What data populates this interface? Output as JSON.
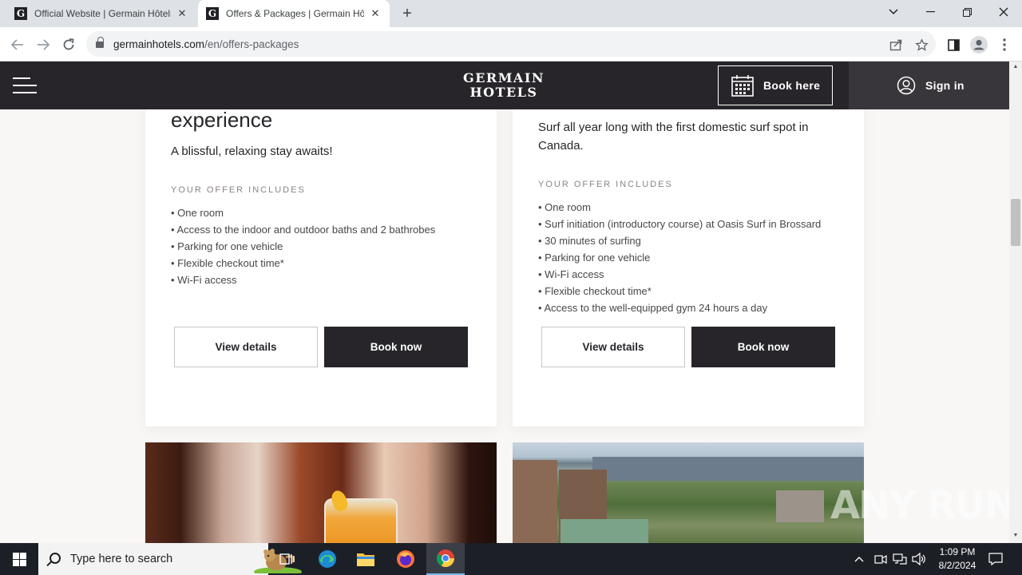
{
  "browser": {
    "tabs": [
      {
        "title": "Official Website | Germain Hôtels",
        "favicon": "G"
      },
      {
        "title": "Offers & Packages | Germain Hôtels",
        "favicon": "G"
      }
    ],
    "address": {
      "host": "germainhotels.com",
      "path": "/en/offers-packages"
    }
  },
  "header": {
    "brand_line1": "GERMAIN",
    "brand_line2": "HOTELS",
    "book_here": "Book here",
    "sign_in": "Sign in"
  },
  "offers": [
    {
      "title": "experience",
      "description": "A blissful, relaxing stay awaits!",
      "includes_title": "YOUR OFFER INCLUDES",
      "items": [
        "One room",
        "Access to the indoor and outdoor baths and 2 bathrobes",
        "Parking for one vehicle",
        "Flexible checkout time*",
        "Wi-Fi access"
      ],
      "view_details": "View details",
      "book_now": "Book now"
    },
    {
      "description": "Surf all year long with the first domestic surf spot in Canada.",
      "includes_title": "YOUR OFFER INCLUDES",
      "items": [
        "One room",
        "Surf initiation (introductory course) at Oasis Surf in Brossard",
        "30 minutes of surfing",
        "Parking for one vehicle",
        "Wi-Fi access",
        "Flexible checkout time*",
        "Access to the well-equipped gym 24 hours a day"
      ],
      "view_details": "View details",
      "book_now": "Book now"
    }
  ],
  "watermark": "ANY RUN",
  "taskbar": {
    "search_placeholder": "Type here to search",
    "time": "1:09 PM",
    "date": "8/2/2024"
  },
  "colors": {
    "header_bg": "#27252a",
    "button_dark": "#27252a",
    "page_bg": "#f8f7f5"
  }
}
